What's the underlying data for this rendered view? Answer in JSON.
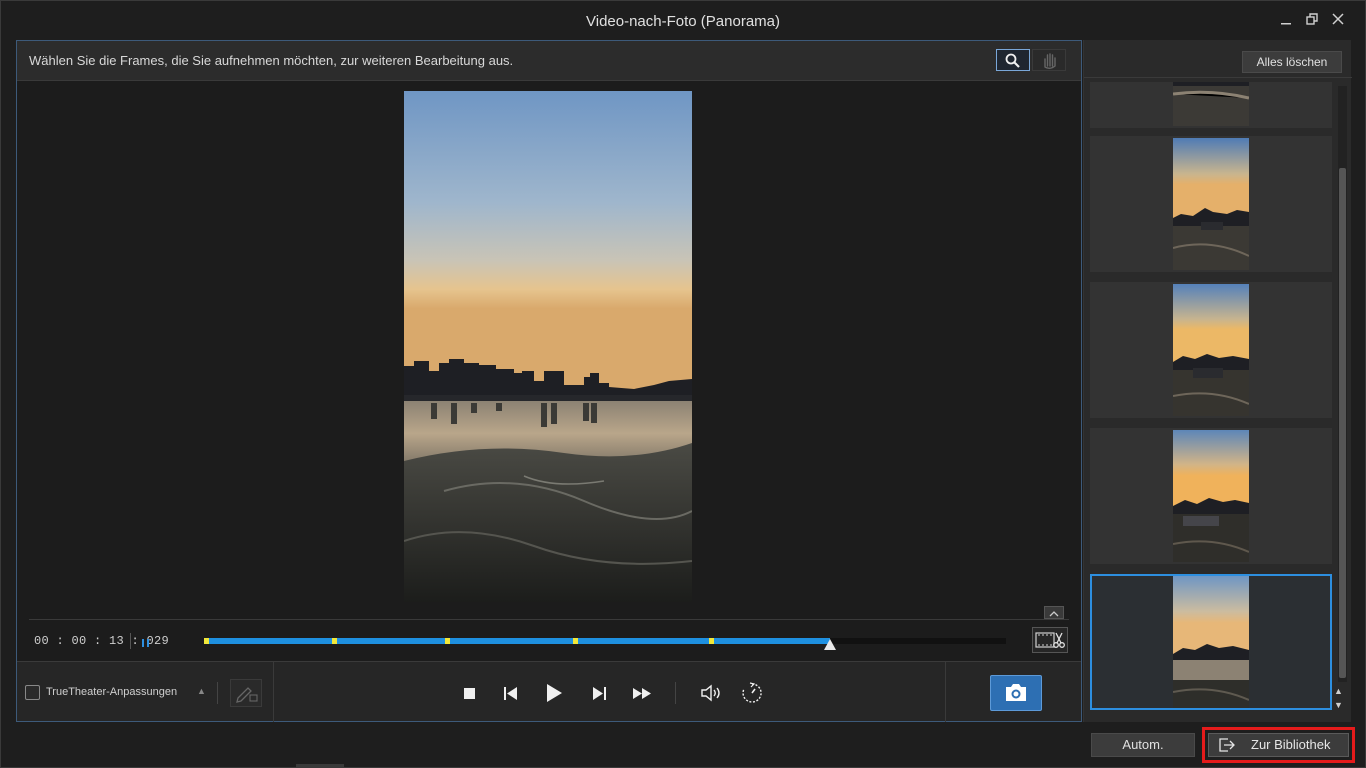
{
  "window": {
    "title": "Video-nach-Foto (Panorama)"
  },
  "toolbar": {
    "hint": "Wählen Sie die Frames, die Sie aufnehmen möchten, zur weiteren Bearbeitung aus.",
    "zoom_tool_icon": "magnifier-icon",
    "pan_tool_icon": "hand-icon"
  },
  "timeline": {
    "current_time": "00 : 00 : 13 : 029",
    "progress": 0.78,
    "markers": [
      0.0,
      0.16,
      0.3,
      0.46,
      0.63
    ]
  },
  "controls": {
    "truetheater_label": "TrueTheater-Anpassungen",
    "truetheater_checked": false
  },
  "frames_panel": {
    "clear_all_label": "Alles löschen",
    "thumbnail_count": 5,
    "selected_index": 4
  },
  "footer": {
    "auto_label": "Autom.",
    "library_label": "Zur Bibliothek"
  },
  "colors": {
    "accent": "#2d6fb3",
    "progress": "#1e90e0",
    "marker": "#f1e83a",
    "highlight": "#e51b1b"
  }
}
